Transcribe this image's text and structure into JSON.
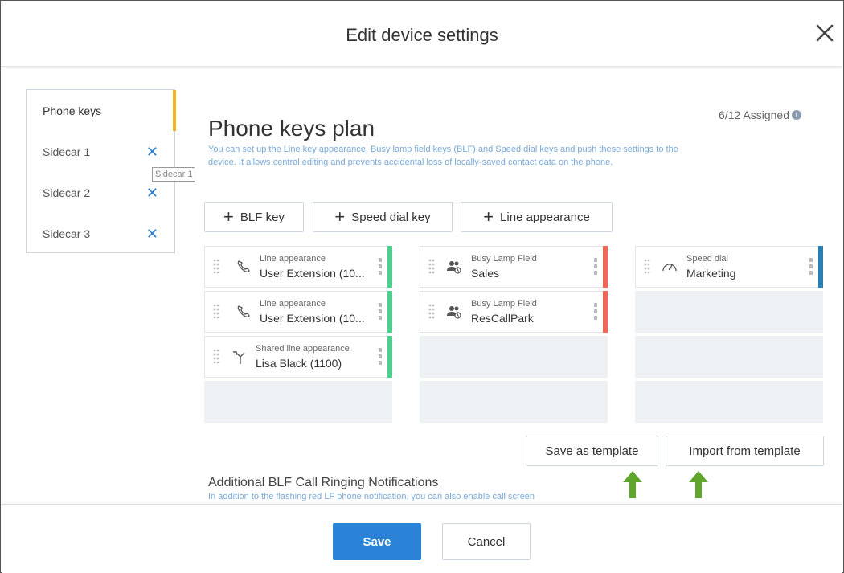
{
  "dialog": {
    "title": "Edit device settings"
  },
  "sidebar": {
    "items": [
      {
        "label": "Phone keys"
      },
      {
        "label": "Sidecar 1",
        "remove": "✕"
      },
      {
        "label": "Sidecar 2",
        "remove": "✕"
      },
      {
        "label": "Sidecar 3",
        "remove": "✕"
      }
    ],
    "tooltip": "Sidecar 1"
  },
  "assigned": {
    "text": "6/12 Assigned",
    "info_glyph": "i"
  },
  "plan": {
    "title": "Phone keys plan",
    "description": "You can set up the Line key appearance, Busy lamp field keys (BLF) and Speed dial keys and push these settings to the device. It allows central editing and prevents accidental loss of locally-saved contact data on the phone."
  },
  "add_buttons": {
    "blf": "BLF key",
    "speed_dial": "Speed dial key",
    "line_appearance": "Line appearance",
    "plus": "+"
  },
  "columns": [
    {
      "keys": [
        {
          "type": "Line appearance",
          "name": "User Extension (10...",
          "icon": "phone-icon",
          "color": "#4cd08d"
        },
        {
          "type": "Line appearance",
          "name": "User Extension (10...",
          "icon": "phone-icon",
          "color": "#4cd08d"
        },
        {
          "type": "Shared line appearance",
          "name": "Lisa Black (1100)",
          "icon": "shared-line-icon",
          "color": "#4cd08d"
        }
      ]
    },
    {
      "keys": [
        {
          "type": "Busy Lamp Field",
          "name": "Sales",
          "icon": "blf-users-icon",
          "color": "#ef6a56"
        },
        {
          "type": "Busy Lamp Field",
          "name": "ResCallPark",
          "icon": "blf-users-icon",
          "color": "#ef6a56"
        }
      ]
    },
    {
      "keys": [
        {
          "type": "Speed dial",
          "name": "Marketing",
          "icon": "speedometer-icon",
          "color": "#2a7fb0"
        }
      ]
    }
  ],
  "templates": {
    "save": "Save as template",
    "import": "Import from template"
  },
  "notifications": {
    "title": "Additional BLF Call Ringing Notifications",
    "description": "In addition to the flashing red LF phone notification, you can also enable call screen"
  },
  "footer": {
    "save": "Save",
    "cancel": "Cancel"
  },
  "colors": {
    "accent": "#2a83d6",
    "active_tab": "#f1b71c",
    "arrow": "#5fa62a"
  }
}
